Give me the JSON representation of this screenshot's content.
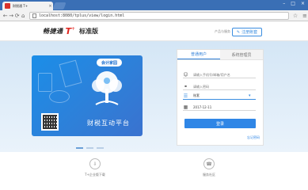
{
  "browser": {
    "tab_title": "财税通 T+",
    "tab_close": "×",
    "url": "localhost:8080/tplus/view/login.html",
    "win_min": "–",
    "win_max": "□",
    "win_close": "×",
    "back_glyph": "←",
    "forward_glyph": "→",
    "reload_glyph": "⟳",
    "home_glyph": "⌂",
    "star_glyph": "☆",
    "menu_glyph": "≡"
  },
  "header": {
    "logo_part1": "畅捷通",
    "logo_t": "T",
    "logo_plus": "+",
    "logo_part2": "标准版",
    "help_link": "产品与服务",
    "register_icon": "✎",
    "register_label": "注册账套"
  },
  "banner": {
    "badge": "会计家园",
    "caption": "财税互动平台",
    "slides": 3,
    "active_slide": 1
  },
  "login": {
    "tabs": [
      {
        "label": "普通用户",
        "active": true
      },
      {
        "label": "系统管理员",
        "active": false
      }
    ],
    "username_placeholder": "请输入手机号/邮箱/用户名",
    "password_placeholder": "请输入密码",
    "account_value": "账套",
    "date_value": "2017-12-11",
    "login_button": "登录",
    "forgot_link": "忘记密码"
  },
  "footer": {
    "items": [
      {
        "label": "T+企业版下载",
        "icon": "download-icon"
      },
      {
        "label": "服务社区",
        "icon": "support-icon"
      }
    ]
  },
  "colors": {
    "accent": "#2f86e6",
    "brand_red": "#e0261f",
    "chrome_blue": "#3a6fb5"
  }
}
